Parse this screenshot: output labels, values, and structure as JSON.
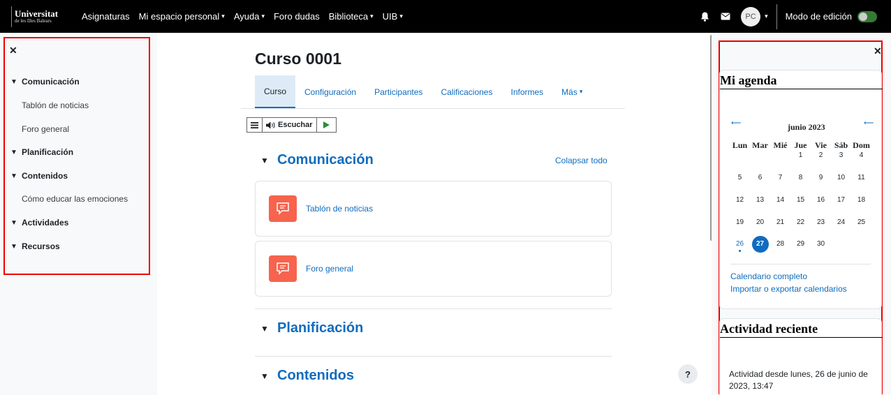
{
  "navbar": {
    "logo_line1": "Universitat",
    "logo_line2": "de les Illes Balears",
    "links": [
      {
        "label": "Asignaturas",
        "dropdown": false
      },
      {
        "label": "Mi espacio personal",
        "dropdown": true
      },
      {
        "label": "Ayuda",
        "dropdown": true
      },
      {
        "label": "Foro dudas",
        "dropdown": false
      },
      {
        "label": "Biblioteca",
        "dropdown": true
      },
      {
        "label": "UIB",
        "dropdown": true
      }
    ],
    "avatar_initials": "PC",
    "edit_mode_label": "Modo de edición",
    "icons": [
      "bell-icon",
      "message-icon"
    ]
  },
  "course_index": {
    "items": [
      {
        "type": "section",
        "label": "Comunicación"
      },
      {
        "type": "item",
        "label": "Tablón de noticias"
      },
      {
        "type": "item",
        "label": "Foro general"
      },
      {
        "type": "section",
        "label": "Planificación"
      },
      {
        "type": "section",
        "label": "Contenidos"
      },
      {
        "type": "item",
        "label": "Cómo educar las emociones"
      },
      {
        "type": "section",
        "label": "Actividades"
      },
      {
        "type": "section",
        "label": "Recursos"
      }
    ]
  },
  "main": {
    "course_title": "Curso 0001",
    "tabs": [
      "Curso",
      "Configuración",
      "Participantes",
      "Calificaciones",
      "Informes",
      "Más"
    ],
    "listen_label": "Escuchar",
    "collapse_all": "Colapsar todo",
    "sections": [
      "Comunicación",
      "Planificación",
      "Contenidos"
    ],
    "activities": [
      "Tablón de noticias",
      "Foro general"
    ],
    "help_label": "?"
  },
  "agenda": {
    "title": "Mi agenda",
    "month": "junio 2023",
    "weekdays": [
      "Lun",
      "Mar",
      "Mié",
      "Jue",
      "Vie",
      "Sáb",
      "Dom"
    ],
    "weeks": [
      [
        "",
        "",
        "",
        "1",
        "2",
        "3",
        "4"
      ],
      [
        "5",
        "6",
        "7",
        "8",
        "9",
        "10",
        "11"
      ],
      [
        "12",
        "13",
        "14",
        "15",
        "16",
        "17",
        "18"
      ],
      [
        "19",
        "20",
        "21",
        "22",
        "23",
        "24",
        "25"
      ],
      [
        "26",
        "27",
        "28",
        "29",
        "30",
        "",
        ""
      ]
    ],
    "today": "27",
    "event_day": "26",
    "link_full": "Calendario completo",
    "link_import": "Importar o exportar calendarios"
  },
  "recent": {
    "title": "Actividad reciente",
    "text": "Actividad desde lunes, 26 de junio de 2023, 13:47"
  },
  "colors": {
    "brand_blue": "#0f6cbf",
    "activity_icon": "#f7634d",
    "highlight_box": "#e00"
  }
}
